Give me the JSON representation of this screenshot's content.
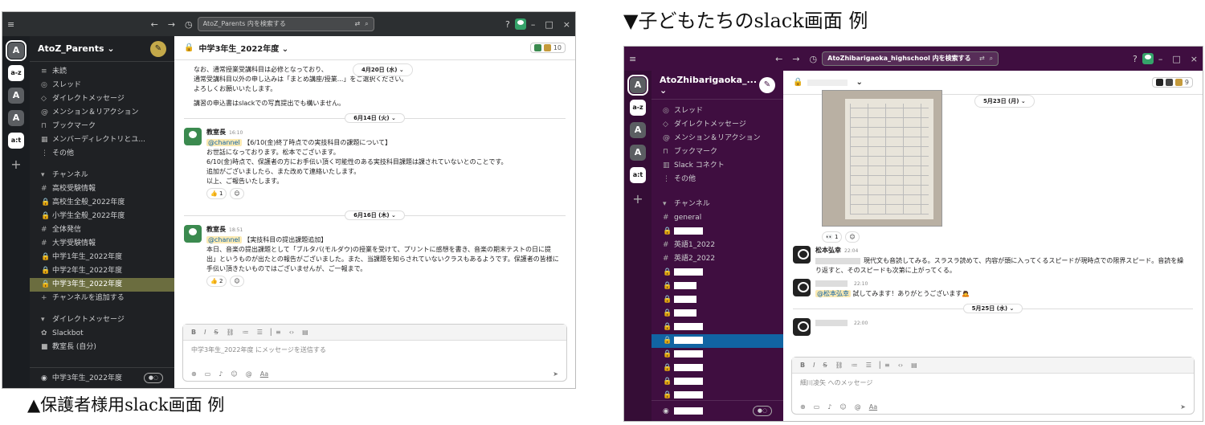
{
  "captions": {
    "parent": "▲保護者様用slack画面 例",
    "kids": "▼子どもたちのslack画面 例"
  },
  "parent_app": {
    "search_placeholder": "AtoZ_Parents 内を検索する",
    "rail": [
      "A",
      "a-z",
      "A",
      "A",
      "a:t"
    ],
    "workspace": "AtoZ_Parents ⌄",
    "nav": [
      {
        "icon": "≡",
        "label": "未読"
      },
      {
        "icon": "◎",
        "label": "スレッド"
      },
      {
        "icon": "◇",
        "label": "ダイレクトメッセージ"
      },
      {
        "icon": "@",
        "label": "メンション＆リアクション"
      },
      {
        "icon": "⊓",
        "label": "ブックマーク"
      },
      {
        "icon": "▦",
        "label": "メンバーディレクトリとユ..."
      },
      {
        "icon": "⋮",
        "label": "その他"
      }
    ],
    "channels_header": "チャンネル",
    "channels": [
      {
        "icon": "#",
        "label": "高校受験情報"
      },
      {
        "icon": "🔒",
        "label": "高校生全般_2022年度"
      },
      {
        "icon": "🔒",
        "label": "小学生全般_2022年度"
      },
      {
        "icon": "#",
        "label": "全体発信"
      },
      {
        "icon": "#",
        "label": "大学受験情報"
      },
      {
        "icon": "🔒",
        "label": "中学1年生_2022年度"
      },
      {
        "icon": "🔒",
        "label": "中学2年生_2022年度"
      },
      {
        "icon": "🔒",
        "label": "中学3年生_2022年度",
        "selected": true
      },
      {
        "icon": "+",
        "label": "チャンネルを追加する"
      }
    ],
    "dm_header": "ダイレクトメッセージ",
    "dms": [
      {
        "label": "Slackbot"
      },
      {
        "label": "教室長 (自分)"
      }
    ],
    "footer_channel": "中学3年生_2022年度",
    "channel_title": "中学3年生_2022年度 ⌄",
    "member_count": "10",
    "top_text": [
      "なお、通常授業受講科目は必修となっており、",
      "通常受講科目以外の申し込みは「まとめ講座/授業...」をご選択ください。",
      "よろしくお願いいたします。",
      "講習の申込書はslackでの写真提出でも構いません。"
    ],
    "date_pill_top": "4月20日 (水) ⌄",
    "date1": "6月14日 (火) ⌄",
    "msg1": {
      "author": "教室長",
      "time": "16:10",
      "mention": "@channel",
      "title": "【6/10(金)終了時点での実技科目の課題について】",
      "lines": [
        "お世話になっております。松本でございます。",
        "6/10(金)時点で、保護者の方にお手伝い頂く可能性のある実技科目課題は課されていないとのことです。",
        "追加がございましたら、また改めて連絡いたします。",
        "以上、ご報告いたします。"
      ],
      "reaction": "👍 1"
    },
    "date2": "6月16日 (木) ⌄",
    "msg2": {
      "author": "教室長",
      "time": "18:51",
      "mention": "@channel",
      "title": "【実技科目の提出課題追加】",
      "lines": [
        "本日、音楽の提出課題として「ブルタバ(モルダウ)の授業を受けて、プリントに感想を書き、音楽の期末テストの日に提",
        "出」というものが出たとの報告がございました。また、当課題を知らされていないクラスもあるようです。保護者の皆様に",
        "手伝い頂きたいものではございませんが、ご一報まで。"
      ],
      "reaction": "👍 2"
    },
    "composer_placeholder": "中学3年生_2022年度 にメッセージを送信する"
  },
  "kids_app": {
    "search_placeholder": "AtoZhibarigaoka_highschool 内を検索する",
    "rail": [
      "A",
      "a-z",
      "A",
      "A",
      "a:t"
    ],
    "workspace": "AtoZhibarigaoka_... ⌄",
    "nav": [
      {
        "icon": "◎",
        "label": "スレッド"
      },
      {
        "icon": "◇",
        "label": "ダイレクトメッセージ"
      },
      {
        "icon": "@",
        "label": "メンション＆リアクション"
      },
      {
        "icon": "⊓",
        "label": "ブックマーク"
      },
      {
        "icon": "▥",
        "label": "Slack コネクト"
      },
      {
        "icon": "⋮",
        "label": "その他"
      }
    ],
    "channels_header": "チャンネル",
    "channels": [
      {
        "icon": "#",
        "label": "general"
      },
      {
        "icon": "🔒",
        "label": ""
      },
      {
        "icon": "#",
        "label": "英語1_2022"
      },
      {
        "icon": "#",
        "label": "英語2_2022"
      },
      {
        "icon": "🔒",
        "label": ""
      },
      {
        "icon": "🔒",
        "label": ""
      },
      {
        "icon": "🔒",
        "label": ""
      },
      {
        "icon": "🔒",
        "label": ""
      },
      {
        "icon": "🔒",
        "label": ""
      },
      {
        "icon": "🔒",
        "label": "",
        "selected": true
      },
      {
        "icon": "🔒",
        "label": ""
      },
      {
        "icon": "🔒",
        "label": ""
      },
      {
        "icon": "🔒",
        "label": ""
      },
      {
        "icon": "🔒",
        "label": ""
      },
      {
        "icon": "🔒",
        "label": ""
      }
    ],
    "member_count": "9",
    "date1": "5月23日 (月) ⌄",
    "photo_reaction": "👀 1",
    "msg1": {
      "author": "松本弘幸",
      "time": "22:04",
      "lines": [
        "現代文も音読してみる。スラスラ読めて、内容が頭に入ってくるスピードが現時点での限界スピード。音読を繰",
        "り返すと、そのスピードも次第に上がってくる。"
      ]
    },
    "msg2": {
      "time": "22:10",
      "mention": "@松本弘幸",
      "text": "試してみます！ありがとうございます🙇"
    },
    "date2": "5月25日 (水) ⌄",
    "msg3": {
      "time": "22:00"
    },
    "composer_placeholder": "細川凌矢 へのメッセージ"
  }
}
